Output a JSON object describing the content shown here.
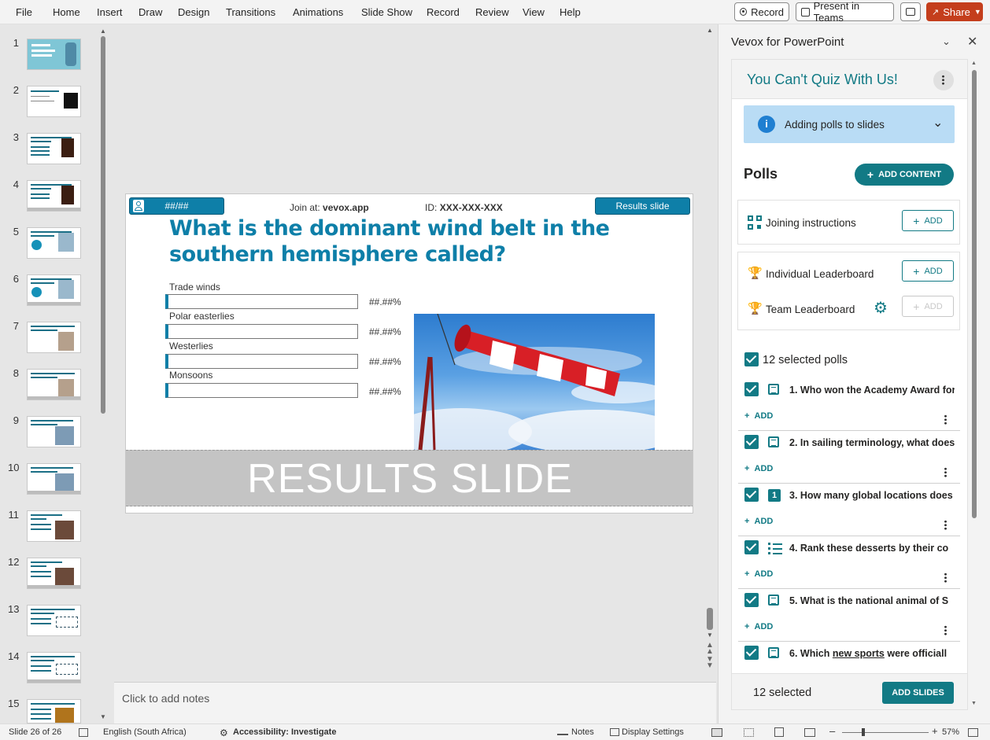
{
  "menu": {
    "items": [
      "File",
      "Home",
      "Insert",
      "Draw",
      "Design",
      "Transitions",
      "Animations",
      "Slide Show",
      "Record",
      "Review",
      "View",
      "Help"
    ],
    "record_label": "Record",
    "present_label": "Present in Teams",
    "share_label": "Share"
  },
  "thumbnails": [
    "1",
    "2",
    "3",
    "4",
    "5",
    "6",
    "7",
    "8",
    "9",
    "10",
    "11",
    "12",
    "13",
    "14",
    "15"
  ],
  "slide": {
    "counter_label": "##/##",
    "join_prefix": "Join at:",
    "join_url": "vevox.app",
    "id_prefix": "ID:",
    "id_value": "XXX-XXX-XXX",
    "results_pill": "Results slide",
    "question": "What is the dominant wind belt in the southern hemisphere called?",
    "options": [
      {
        "label": "Trade winds",
        "pct": "##.##%"
      },
      {
        "label": "Polar easterlies",
        "pct": "##.##%"
      },
      {
        "label": "Westerlies",
        "pct": "##.##%"
      },
      {
        "label": "Monsoons",
        "pct": "##.##%"
      }
    ],
    "results_band": "RESULTS SLIDE"
  },
  "notes_placeholder": "Click to add notes",
  "pane": {
    "title": "Vevox for PowerPoint",
    "session_title": "You Can't Quiz With Us!",
    "info_label": "Adding polls to slides",
    "polls_heading": "Polls",
    "add_content_label": "ADD CONTENT",
    "joining_label": "Joining instructions",
    "individual_label": "Individual Leaderboard",
    "team_label": "Team Leaderboard",
    "add_label": "ADD",
    "selected_polls_label": "12 selected polls",
    "polls": [
      {
        "title": "1. Who won the Academy Award for",
        "add": "ADD"
      },
      {
        "title": "2. In sailing terminology, what does",
        "add": "ADD"
      },
      {
        "title": "3. How many global locations does",
        "add": "ADD"
      },
      {
        "title": "4. Rank these desserts by their co",
        "add": "ADD"
      },
      {
        "title": "5. What is the national animal of S",
        "add": "ADD"
      }
    ],
    "poll6_prefix": "6. Which ",
    "poll6_underlined": "new sports",
    "poll6_suffix": " were officiall",
    "footer_selected": "12 selected",
    "add_slides_label": "ADD SLIDES"
  },
  "status": {
    "slide_info": "Slide 26 of 26",
    "language": "English (South Africa)",
    "accessibility": "Accessibility: Investigate",
    "notes": "Notes",
    "display_settings": "Display Settings",
    "zoom": "57%"
  },
  "colors": {
    "teal": "#127a85",
    "vevox_blue": "#0e7fa8",
    "share": "#c43e1c"
  }
}
